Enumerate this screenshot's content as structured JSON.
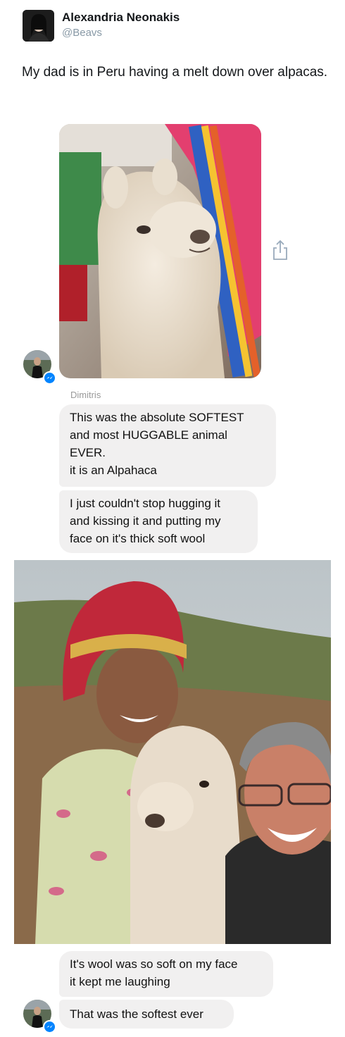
{
  "tweet": {
    "author_name": "Alexandria Neonakis",
    "author_handle": "@Beavs",
    "text": "My dad is in Peru having a melt down over alpacas."
  },
  "conversation": {
    "sender_name": "Dimitris",
    "bubble1_lines": [
      "This was the absolute SOFTEST",
      "and most HUGGABLE animal",
      "EVER.",
      "it is an Alpahaca"
    ],
    "bubble2_lines": [
      "I just couldn't stop hugging it",
      "and kissing it and putting my",
      "face on it's thick soft wool"
    ],
    "bubble3_lines": [
      "It's wool was so soft on my face",
      "it kept me laughing"
    ],
    "bubble4_lines": [
      "That was the softest ever"
    ]
  },
  "colors": {
    "bubble_bg": "#f1f0f0",
    "messenger_blue": "#0084ff",
    "handle_gray": "#8899a6"
  },
  "icons": [
    "messenger-badge-icon",
    "share-icon"
  ]
}
